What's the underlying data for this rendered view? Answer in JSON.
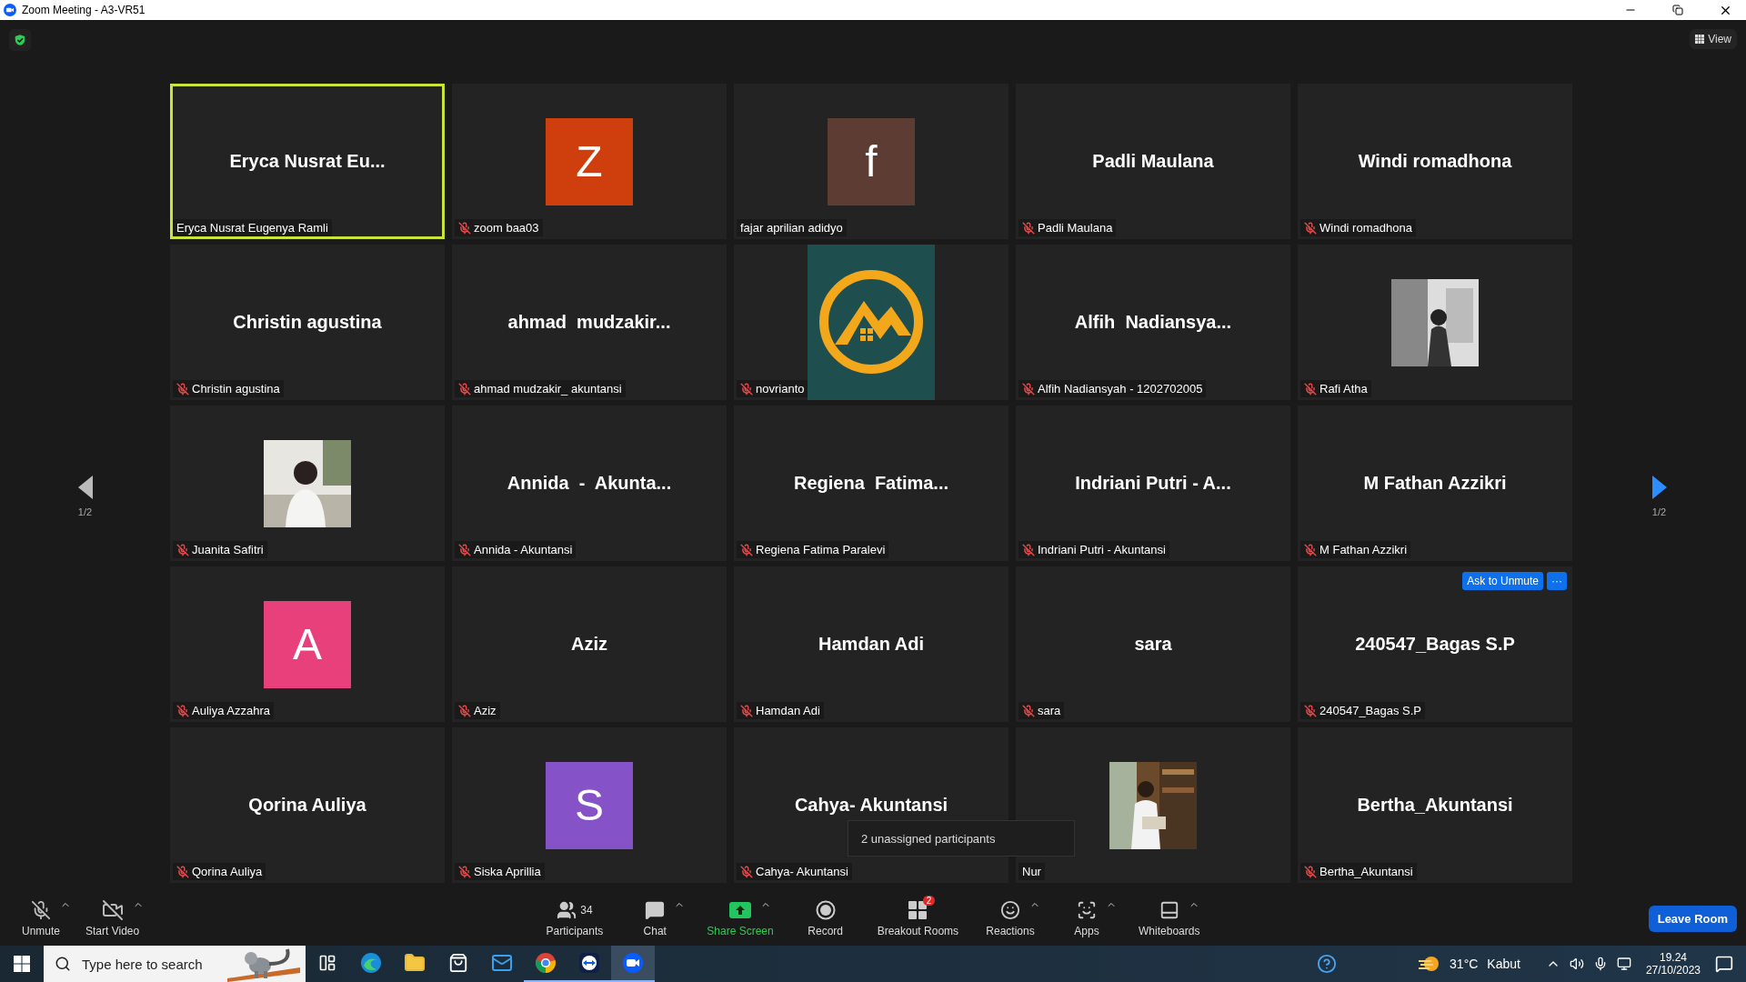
{
  "window": {
    "title": "Zoom Meeting - A3-VR51"
  },
  "top_bar": {
    "view_label": "View"
  },
  "pager": {
    "left": "1/2",
    "right": "1/2"
  },
  "tiles": [
    {
      "kind": "name",
      "display_name": "Eryca Nusrat Eu...",
      "label": "Eryca Nusrat Eugenya Ramli",
      "muted": false,
      "active_speaker": true
    },
    {
      "kind": "letter",
      "letter": "Z",
      "color": "#cf3f0e",
      "label": "zoom baa03",
      "muted": true,
      "active_speaker": false
    },
    {
      "kind": "letter",
      "letter": "f",
      "color": "#5d3d33",
      "label": "fajar aprilian adidyo",
      "muted": false,
      "active_speaker": false
    },
    {
      "kind": "name",
      "display_name": "Padli Maulana",
      "label": "Padli Maulana",
      "muted": true,
      "active_speaker": false
    },
    {
      "kind": "name",
      "display_name": "Windi romadhona",
      "label": "Windi romadhona",
      "muted": true,
      "active_speaker": false
    },
    {
      "kind": "name",
      "display_name": "Christin agustina",
      "label": "Christin agustina",
      "muted": true,
      "active_speaker": false
    },
    {
      "kind": "name",
      "display_name": "ahmad  mudzakir...",
      "label": "ahmad mudzakir_ akuntansi",
      "muted": true,
      "active_speaker": false
    },
    {
      "kind": "logo",
      "label": "novrianto",
      "muted": true,
      "active_speaker": false
    },
    {
      "kind": "name",
      "display_name": "Alfih  Nadiansya...",
      "label": "Alfih Nadiansyah - 1202702005",
      "muted": true,
      "active_speaker": false
    },
    {
      "kind": "picture",
      "label": "Rafi Atha",
      "muted": true,
      "active_speaker": false
    },
    {
      "kind": "picture",
      "label": "Juanita Safitri",
      "muted": true,
      "active_speaker": false
    },
    {
      "kind": "name",
      "display_name": "Annida  -  Akunta...",
      "label": "Annida - Akuntansi",
      "muted": true,
      "active_speaker": false
    },
    {
      "kind": "name",
      "display_name": "Regiena  Fatima...",
      "label": "Regiena Fatima Paralevi",
      "muted": true,
      "active_speaker": false
    },
    {
      "kind": "name",
      "display_name": "Indriani Putri - A...",
      "label": "Indriani Putri - Akuntansi",
      "muted": true,
      "active_speaker": false
    },
    {
      "kind": "name",
      "display_name": "M Fathan Azzikri",
      "label": "M Fathan Azzikri",
      "muted": true,
      "active_speaker": false
    },
    {
      "kind": "letter",
      "letter": "A",
      "color": "#e8407a",
      "label": "Auliya Azzahra",
      "muted": true,
      "active_speaker": false
    },
    {
      "kind": "name",
      "display_name": "Aziz",
      "label": "Aziz",
      "muted": true,
      "active_speaker": false
    },
    {
      "kind": "name",
      "display_name": "Hamdan Adi",
      "label": "Hamdan Adi",
      "muted": true,
      "active_speaker": false
    },
    {
      "kind": "name",
      "display_name": "sara",
      "label": "sara",
      "muted": true,
      "active_speaker": false
    },
    {
      "kind": "name",
      "display_name": "240547_Bagas S.P",
      "label": "240547_Bagas S.P",
      "muted": true,
      "active_speaker": false,
      "actions": [
        "Ask to Unmute",
        "···"
      ]
    },
    {
      "kind": "name",
      "display_name": "Qorina Auliya",
      "label": "Qorina Auliya",
      "muted": true,
      "active_speaker": false
    },
    {
      "kind": "letter",
      "letter": "S",
      "color": "#8652c8",
      "label": "Siska Aprillia",
      "muted": true,
      "active_speaker": false
    },
    {
      "kind": "name",
      "display_name": "Cahya- Akuntansi",
      "label": "Cahya- Akuntansi",
      "muted": true,
      "active_speaker": false
    },
    {
      "kind": "picture",
      "label": "Nur",
      "muted": false,
      "active_speaker": false
    },
    {
      "kind": "name",
      "display_name": "Bertha_Akuntansi",
      "label": "Bertha_Akuntansi",
      "muted": true,
      "active_speaker": false
    }
  ],
  "tooltip": "2 unassigned participants",
  "toolbar": {
    "left": [
      {
        "kind": "mic",
        "label": "Unmute",
        "caret": true
      },
      {
        "kind": "video",
        "label": "Start Video",
        "caret": true
      }
    ],
    "center": [
      {
        "kind": "participants",
        "label": "Participants",
        "count": "34",
        "caret": false,
        "highlight": false
      },
      {
        "kind": "chat",
        "label": "Chat",
        "caret": true,
        "highlight": false
      },
      {
        "kind": "share",
        "label": "Share Screen",
        "caret": true,
        "highlight": true
      },
      {
        "kind": "record",
        "label": "Record",
        "caret": false,
        "highlight": false
      },
      {
        "kind": "breakout",
        "label": "Breakout Rooms",
        "badge": "2",
        "caret": false,
        "highlight": false
      },
      {
        "kind": "reactions",
        "label": "Reactions",
        "caret": true,
        "highlight": false
      },
      {
        "kind": "apps",
        "label": "Apps",
        "caret": true,
        "highlight": false
      },
      {
        "kind": "whiteboards",
        "label": "Whiteboards",
        "caret": true,
        "highlight": false
      }
    ],
    "leave": "Leave Room"
  },
  "taskbar": {
    "search_placeholder": "Type here to search",
    "apps": [
      {
        "kind": "taskview",
        "running": false,
        "selected": false
      },
      {
        "kind": "edge",
        "running": false,
        "selected": false
      },
      {
        "kind": "explorer",
        "running": false,
        "selected": false
      },
      {
        "kind": "store",
        "running": false,
        "selected": false
      },
      {
        "kind": "mail",
        "running": false,
        "selected": false
      },
      {
        "kind": "chrome",
        "running": true,
        "selected": false
      },
      {
        "kind": "teamviewer",
        "running": true,
        "selected": false
      },
      {
        "kind": "zoom",
        "running": true,
        "selected": true
      }
    ],
    "temperature": "31°C",
    "weather": "Kabut",
    "time": "19.24",
    "date": "27/10/2023"
  }
}
